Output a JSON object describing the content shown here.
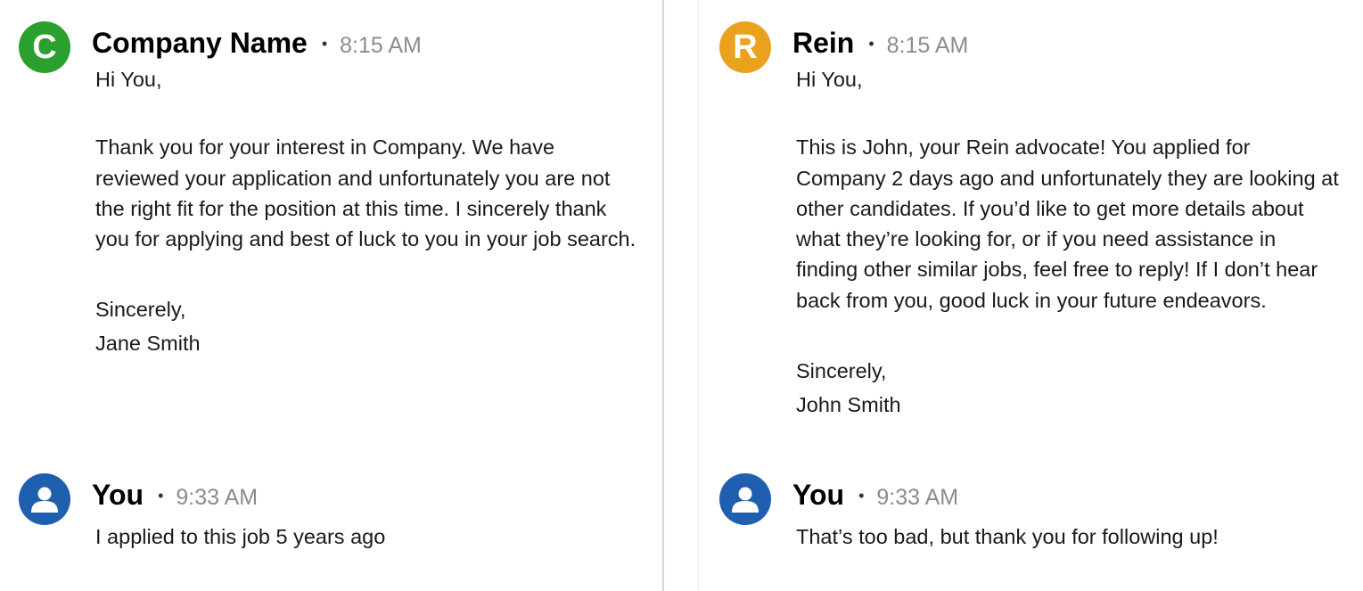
{
  "left": {
    "first": {
      "avatar_letter": "C",
      "avatar_color": "#2aa02e",
      "sender": "Company Name",
      "time": "8:15 AM",
      "greeting": "Hi You,",
      "paragraph": "Thank you for your interest in Company. We have reviewed your application and unfortunately you are not the right fit for the position at this time. I sincerely thank you for applying and best of luck to you in your job search.",
      "closing": "Sincerely,",
      "signature": "Jane Smith"
    },
    "reply": {
      "avatar_icon": "person-icon",
      "avatar_color": "#1f5fb0",
      "sender": "You",
      "time": "9:33 AM",
      "text": "I applied to this job 5 years ago"
    }
  },
  "right": {
    "first": {
      "avatar_letter": "R",
      "avatar_color": "#eaa11e",
      "sender": "Rein",
      "time": "8:15 AM",
      "greeting": "Hi You,",
      "paragraph": "This is John, your Rein advocate! You applied for Company 2 days ago and unfortunately they are looking at other candidates. If you’d like to get more details about what they’re looking for, or if you need assistance in finding other similar jobs, feel free to reply! If I don’t hear back from you, good luck in your future endeavors.",
      "closing": "Sincerely,",
      "signature": "John Smith"
    },
    "reply": {
      "avatar_icon": "person-icon",
      "avatar_color": "#1f5fb0",
      "sender": "You",
      "time": "9:33 AM",
      "text": "That’s too bad, but thank you for following up!"
    }
  },
  "separator_dot": "•"
}
